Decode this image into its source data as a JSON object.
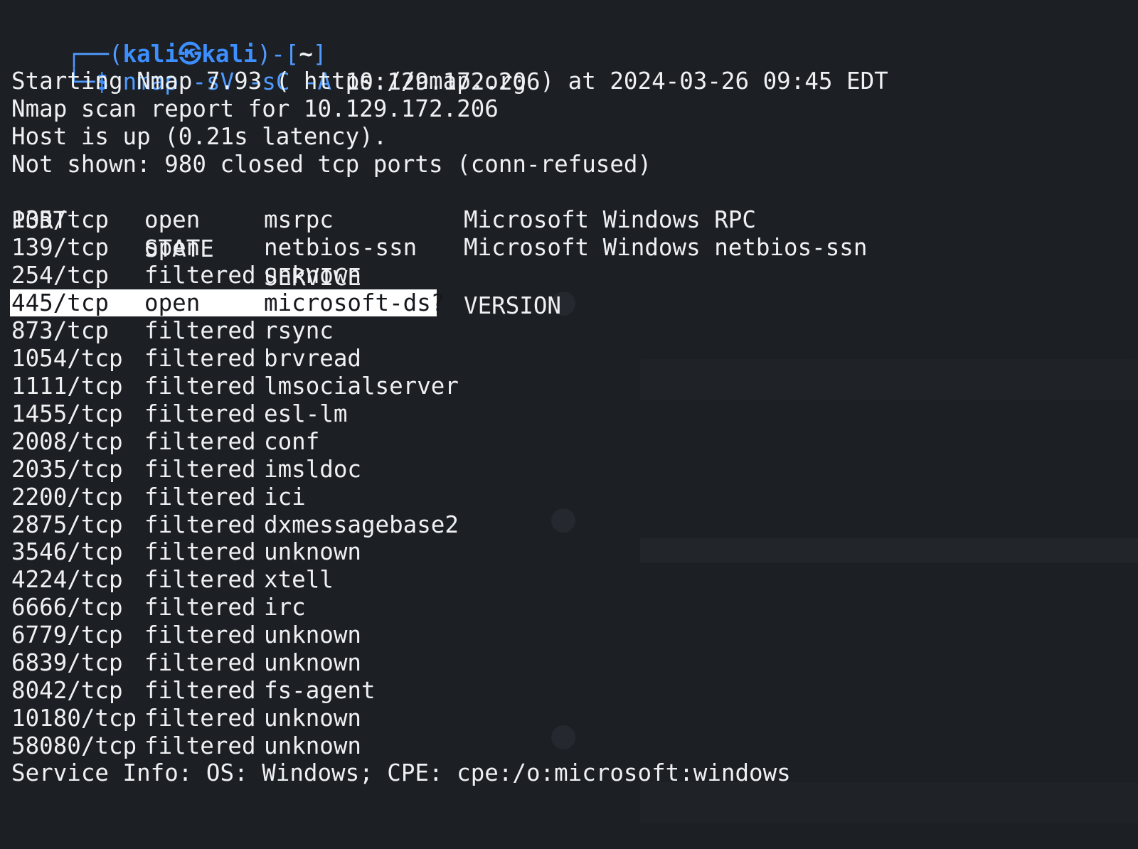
{
  "prompt": {
    "box_top": "┌──(",
    "user": "kali",
    "at_symbol": "㉿",
    "host": "kali",
    "close_paren": ")-[",
    "cwd": "~",
    "close_bracket": "]",
    "box_bottom": "└─",
    "dollar": "$",
    "command_tool": "nmap",
    "command_flags": "-sV -sC -A",
    "command_target": "10.129.172.206"
  },
  "output": {
    "starting": "Starting Nmap 7.93 ( https://nmap.org ) at 2024-03-26 09:45 EDT",
    "report": "Nmap scan report for 10.129.172.206",
    "host_up": "Host is up (0.21s latency).",
    "not_shown": "Not shown: 980 closed tcp ports (conn-refused)",
    "headers": {
      "port": "PORT",
      "state": "STATE",
      "service": "SERVICE",
      "version": "VERSION"
    },
    "rows": [
      {
        "port": "135/tcp",
        "state": "open",
        "service": "msrpc",
        "version": "Microsoft Windows RPC"
      },
      {
        "port": "139/tcp",
        "state": "open",
        "service": "netbios-ssn",
        "version": "Microsoft Windows netbios-ssn"
      },
      {
        "port": "254/tcp",
        "state": "filtered",
        "service": "unknown",
        "version": ""
      },
      {
        "port": "445/tcp",
        "state": "open",
        "service": "microsoft-ds?",
        "version": ""
      },
      {
        "port": "873/tcp",
        "state": "filtered",
        "service": "rsync",
        "version": ""
      },
      {
        "port": "1054/tcp",
        "state": "filtered",
        "service": "brvread",
        "version": ""
      },
      {
        "port": "1111/tcp",
        "state": "filtered",
        "service": "lmsocialserver",
        "version": ""
      },
      {
        "port": "1455/tcp",
        "state": "filtered",
        "service": "esl-lm",
        "version": ""
      },
      {
        "port": "2008/tcp",
        "state": "filtered",
        "service": "conf",
        "version": ""
      },
      {
        "port": "2035/tcp",
        "state": "filtered",
        "service": "imsldoc",
        "version": ""
      },
      {
        "port": "2200/tcp",
        "state": "filtered",
        "service": "ici",
        "version": ""
      },
      {
        "port": "2875/tcp",
        "state": "filtered",
        "service": "dxmessagebase2",
        "version": ""
      },
      {
        "port": "3546/tcp",
        "state": "filtered",
        "service": "unknown",
        "version": ""
      },
      {
        "port": "4224/tcp",
        "state": "filtered",
        "service": "xtell",
        "version": ""
      },
      {
        "port": "6666/tcp",
        "state": "filtered",
        "service": "irc",
        "version": ""
      },
      {
        "port": "6779/tcp",
        "state": "filtered",
        "service": "unknown",
        "version": ""
      },
      {
        "port": "6839/tcp",
        "state": "filtered",
        "service": "unknown",
        "version": ""
      },
      {
        "port": "8042/tcp",
        "state": "filtered",
        "service": "fs-agent",
        "version": ""
      },
      {
        "port": "10180/tcp",
        "state": "filtered",
        "service": "unknown",
        "version": ""
      },
      {
        "port": "58080/tcp",
        "state": "filtered",
        "service": "unknown",
        "version": ""
      }
    ],
    "service_info": "Service Info: OS: Windows; CPE: cpe:/o:microsoft:windows"
  },
  "colors": {
    "background": "#1c1f24",
    "text": "#eef0f2",
    "prompt_blue": "#3d8fff",
    "highlight_bg": "#ffffff",
    "highlight_text": "#16181c"
  }
}
